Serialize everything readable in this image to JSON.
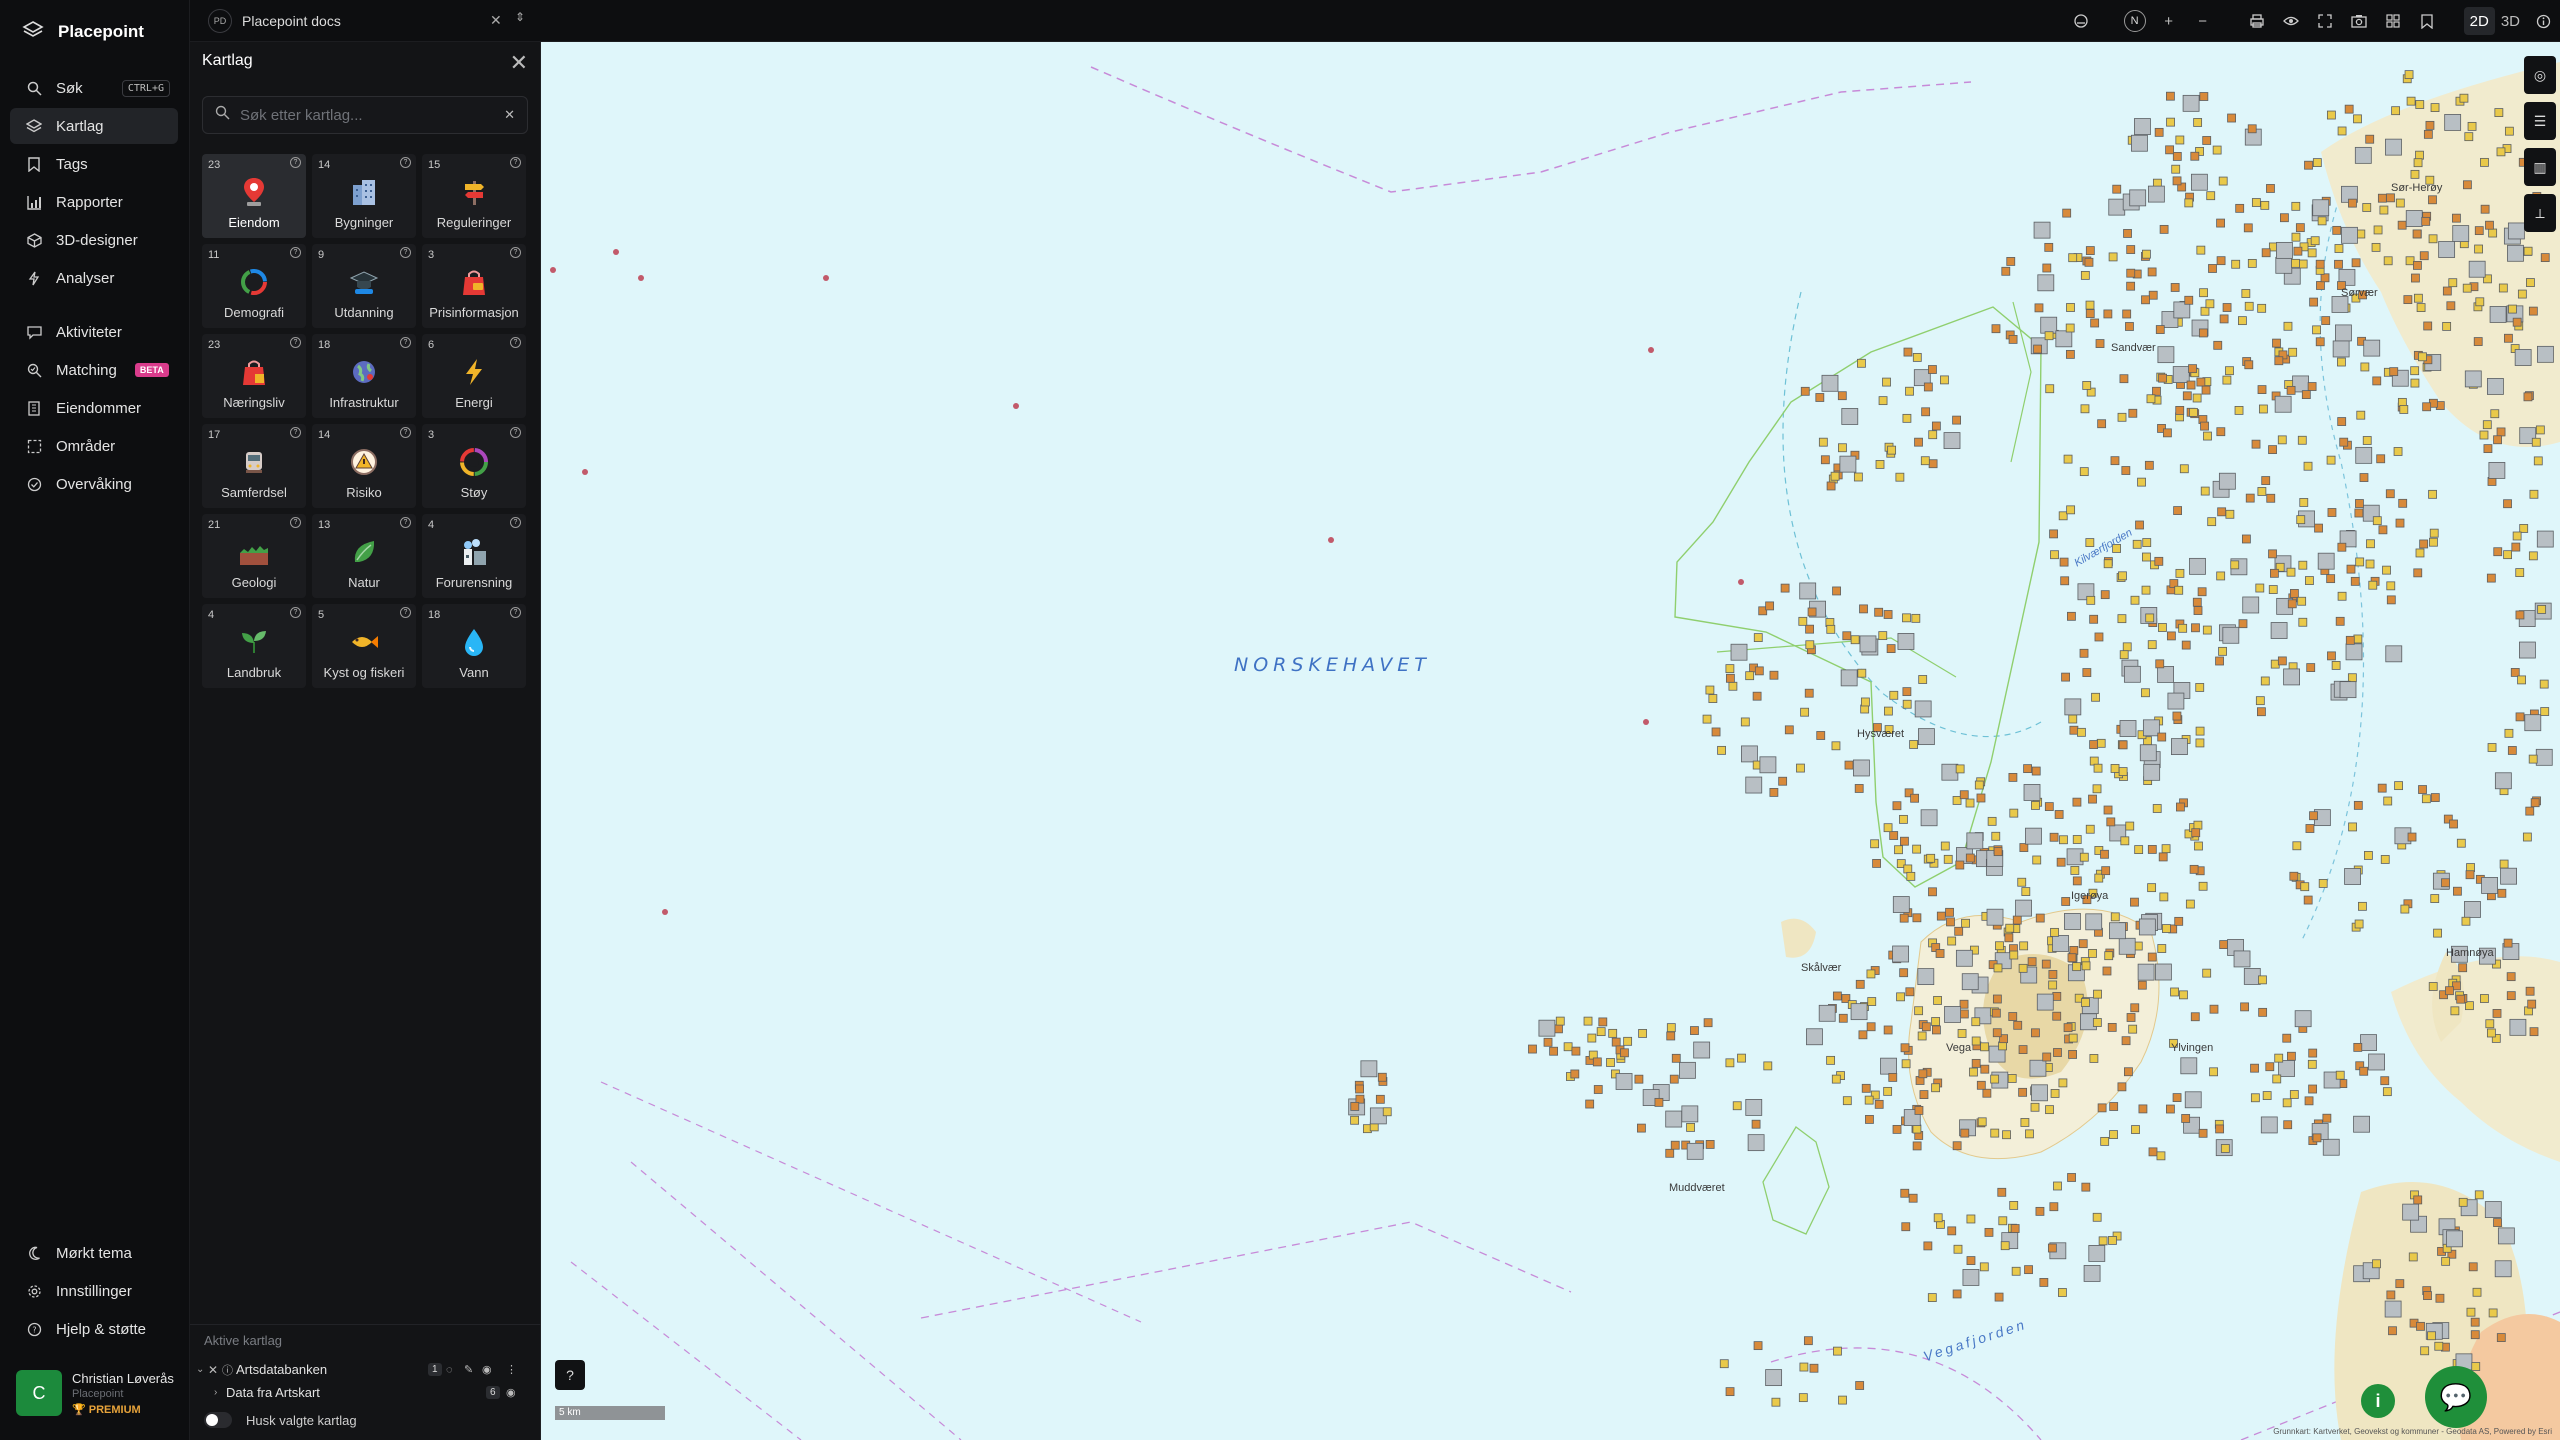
{
  "app": {
    "name": "Placepoint"
  },
  "nav": {
    "items": [
      {
        "id": "sok",
        "label": "Søk",
        "shortcut": "CTRL+G",
        "icon": "search-icon"
      },
      {
        "id": "kartlag",
        "label": "Kartlag",
        "icon": "layers-icon",
        "active": true
      },
      {
        "id": "tags",
        "label": "Tags",
        "icon": "bookmark-icon"
      },
      {
        "id": "rapporter",
        "label": "Rapporter",
        "icon": "bar-chart-icon"
      },
      {
        "id": "3d",
        "label": "3D-designer",
        "icon": "cube-icon"
      },
      {
        "id": "analyser",
        "label": "Analyser",
        "icon": "bolt-icon"
      },
      {
        "id": "aktiviteter",
        "label": "Aktiviteter",
        "icon": "chat-icon"
      },
      {
        "id": "matching",
        "label": "Matching",
        "badge": "BETA",
        "icon": "match-icon"
      },
      {
        "id": "eiendommer",
        "label": "Eiendommer",
        "icon": "building-icon"
      },
      {
        "id": "omrader",
        "label": "Områder",
        "icon": "area-icon"
      },
      {
        "id": "overvaking",
        "label": "Overvåking",
        "icon": "check-circle-icon"
      }
    ],
    "bottom": [
      {
        "id": "theme",
        "label": "Mørkt tema",
        "icon": "moon-icon"
      },
      {
        "id": "settings",
        "label": "Innstillinger",
        "icon": "gear-icon"
      },
      {
        "id": "help",
        "label": "Hjelp & støtte",
        "icon": "help-icon"
      }
    ],
    "user": {
      "initial": "C",
      "name": "Christian Løverås",
      "org": "Placepoint",
      "plan": "PREMIUM"
    }
  },
  "topbar": {
    "doc_initials": "PD",
    "doc_title": "Placepoint docs",
    "compass": "N",
    "view_2d": "2D",
    "view_3d": "3D"
  },
  "panel": {
    "title": "Kartlag",
    "search_placeholder": "Søk etter kartlag...",
    "tiles": [
      {
        "count": "23",
        "label": "Eiendom",
        "icon": "pin-icon",
        "active": true
      },
      {
        "count": "14",
        "label": "Bygninger",
        "icon": "buildings-icon"
      },
      {
        "count": "15",
        "label": "Reguleringer",
        "icon": "signpost-icon"
      },
      {
        "count": "11",
        "label": "Demografi",
        "icon": "chart-ring-icon"
      },
      {
        "count": "9",
        "label": "Utdanning",
        "icon": "graduation-icon"
      },
      {
        "count": "3",
        "label": "Prisinformasjon",
        "icon": "price-icon"
      },
      {
        "count": "23",
        "label": "Næringsliv",
        "icon": "shopping-bag-icon"
      },
      {
        "count": "18",
        "label": "Infrastruktur",
        "icon": "globe-icon"
      },
      {
        "count": "6",
        "label": "Energi",
        "icon": "lightning-icon"
      },
      {
        "count": "17",
        "label": "Samferdsel",
        "icon": "bus-icon"
      },
      {
        "count": "14",
        "label": "Risiko",
        "icon": "warning-icon"
      },
      {
        "count": "3",
        "label": "Støy",
        "icon": "noise-gauge-icon"
      },
      {
        "count": "21",
        "label": "Geologi",
        "icon": "terrain-icon"
      },
      {
        "count": "13",
        "label": "Natur",
        "icon": "leaf-icon"
      },
      {
        "count": "4",
        "label": "Forurensning",
        "icon": "factory-icon"
      },
      {
        "count": "4",
        "label": "Landbruk",
        "icon": "sprout-icon"
      },
      {
        "count": "5",
        "label": "Kyst og fiskeri",
        "icon": "fish-icon"
      },
      {
        "count": "18",
        "label": "Vann",
        "icon": "water-drop-icon"
      }
    ],
    "active_heading": "Aktive kartlag",
    "active_layers": [
      {
        "name": "Artsdatabanken",
        "count": "1"
      },
      {
        "name": "Data fra Artskart",
        "count": "6"
      }
    ],
    "remember_label": "Husk valgte kartlag"
  },
  "map": {
    "sea_label": "NORSKEHAVET",
    "labels": [
      "Vega",
      "Igerøya",
      "Ylvingen",
      "Muddværet",
      "Hysværet",
      "Vegafjorden",
      "Kilværfjorden",
      "Sørvær",
      "Sør-Herøy",
      "Hamnøya",
      "Sandvær",
      "Skålvær"
    ],
    "scale": "5 km",
    "credits": "Grunnkart: Kartverket, Geovekst og kommuner - Geodata AS, Powered by Esri"
  }
}
